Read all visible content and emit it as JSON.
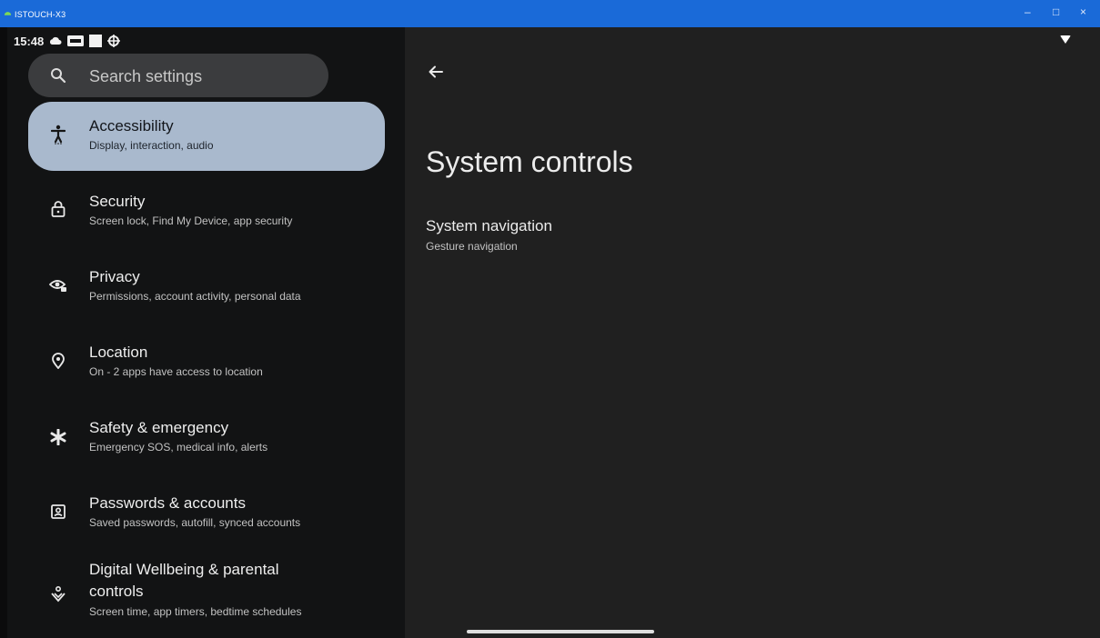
{
  "window": {
    "title": "ISTOUCH-X3",
    "minimize": "–",
    "maximize": "□",
    "close": "×"
  },
  "status_bar": {
    "time": "15:48"
  },
  "search": {
    "placeholder": "Search settings"
  },
  "settings_list": [
    {
      "title": "Accessibility",
      "subtitle": "Display, interaction, audio",
      "icon": "accessibility-icon",
      "selected": true
    },
    {
      "title": "Security",
      "subtitle": "Screen lock, Find My Device, app security",
      "icon": "lock-icon"
    },
    {
      "title": "Privacy",
      "subtitle": "Permissions, account activity, personal data",
      "icon": "privacy-eye-icon"
    },
    {
      "title": "Location",
      "subtitle": "On - 2 apps have access to location",
      "icon": "location-pin-icon"
    },
    {
      "title": "Safety & emergency",
      "subtitle": "Emergency SOS, medical info, alerts",
      "icon": "asterisk-icon"
    },
    {
      "title": "Passwords & accounts",
      "subtitle": "Saved passwords, autofill, synced accounts",
      "icon": "account-box-icon"
    },
    {
      "title_line1": "Digital Wellbeing & parental",
      "title_line2": "controls",
      "subtitle": "Screen time, app timers, bedtime schedules",
      "icon": "wellbeing-icon"
    }
  ],
  "detail": {
    "title": "System controls",
    "items": [
      {
        "title": "System navigation",
        "subtitle": "Gesture navigation"
      }
    ]
  },
  "colors": {
    "titlebar": "#1a6ad8",
    "left_pane": "#121314",
    "right_pane": "#202020",
    "selected_item": "#a9b9cd",
    "search_bg": "#3b3c3e"
  }
}
